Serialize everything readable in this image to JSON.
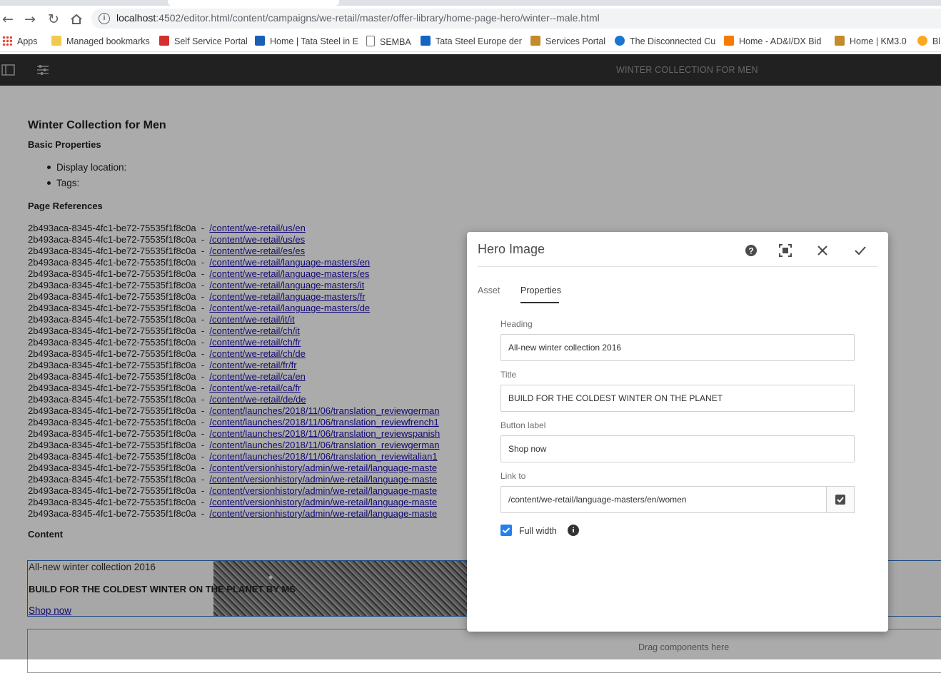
{
  "browser": {
    "url_host": "localhost",
    "url_rest": ":4502/editor.html/content/campaigns/we-retail/master/offer-library/home-page-hero/winter--male.html",
    "bookmarks": [
      {
        "label": "Apps",
        "icon": "apps-grid-icon",
        "color": "#e8453c"
      },
      {
        "label": "Managed bookmarks",
        "icon": "folder-icon",
        "color": "#f2c94c"
      },
      {
        "label": "Self Service Portal",
        "icon": "good-logo-icon",
        "color": "#d32f2f"
      },
      {
        "label": "Home | Tata Steel in E",
        "icon": "site-icon",
        "color": "#1a5fb4"
      },
      {
        "label": "SEMBA",
        "icon": "page-icon",
        "color": "#9e9e9e"
      },
      {
        "label": "Tata Steel Europe der",
        "icon": "tools-icon",
        "color": "#1565c0"
      },
      {
        "label": "Services Portal",
        "icon": "image-icon",
        "color": "#c28b2c"
      },
      {
        "label": "The Disconnected Cu",
        "icon": "cloud-icon",
        "color": "#1976d2"
      },
      {
        "label": "Home - AD&I/DX Bid",
        "icon": "grid-icon",
        "color": "#f57c00"
      },
      {
        "label": "Home | KM3.0",
        "icon": "image-icon",
        "color": "#c28b2c"
      },
      {
        "label": "Bl",
        "icon": "badge-icon",
        "color": "#f9a825"
      }
    ]
  },
  "editor": {
    "header_title": "WINTER COLLECTION FOR MEN"
  },
  "page": {
    "title": "Winter Collection for Men",
    "basic_properties_heading": "Basic Properties",
    "display_location_label": "Display location:",
    "tags_label": "Tags:",
    "page_references_heading": "Page References",
    "ref_id": "2b493aca-8345-4fc1-be72-75535f1f8c0a  -  ",
    "references": [
      "/content/we-retail/us/en ",
      "/content/we-retail/us/es ",
      "/content/we-retail/es/es ",
      "/content/we-retail/language-masters/en ",
      "/content/we-retail/language-masters/es ",
      "/content/we-retail/language-masters/it ",
      "/content/we-retail/language-masters/fr ",
      "/content/we-retail/language-masters/de ",
      "/content/we-retail/it/it ",
      "/content/we-retail/ch/it ",
      "/content/we-retail/ch/fr ",
      "/content/we-retail/ch/de ",
      "/content/we-retail/fr/fr ",
      "/content/we-retail/ca/en ",
      "/content/we-retail/ca/fr ",
      "/content/we-retail/de/de ",
      "/content/launches/2018/11/06/translation_reviewgerman",
      "/content/launches/2018/11/06/translation_reviewfrench1",
      "/content/launches/2018/11/06/translation_reviewspanish",
      "/content/launches/2018/11/06/translation_reviewgerman",
      "/content/launches/2018/11/06/translation_reviewitalian1",
      "/content/versionhistory/admin/we-retail/language-maste",
      "/content/versionhistory/admin/we-retail/language-maste",
      "/content/versionhistory/admin/we-retail/language-maste",
      "/content/versionhistory/admin/we-retail/language-maste",
      "/content/versionhistory/admin/we-retail/language-maste"
    ],
    "content_heading": "Content",
    "hero_heading": "All-new winter collection 2016",
    "hero_title": "BUILD FOR THE COLDEST WINTER ON THE PLANET BY MS",
    "hero_link": "Shop now",
    "dropzone_label": "Drag components here"
  },
  "dialog": {
    "title": "Hero Image",
    "tabs": [
      "Asset",
      "Properties"
    ],
    "active_tab": "Properties",
    "fields": {
      "heading_label": "Heading",
      "heading_value": "All-new winter collection 2016",
      "title_label": "Title",
      "title_value": "BUILD FOR THE COLDEST WINTER ON THE PLANET",
      "button_label_label": "Button label",
      "button_label_value": "Shop now",
      "link_label": "Link to",
      "link_value": "/content/we-retail/language-masters/en/women",
      "full_width_label": "Full width",
      "full_width_checked": true
    }
  }
}
